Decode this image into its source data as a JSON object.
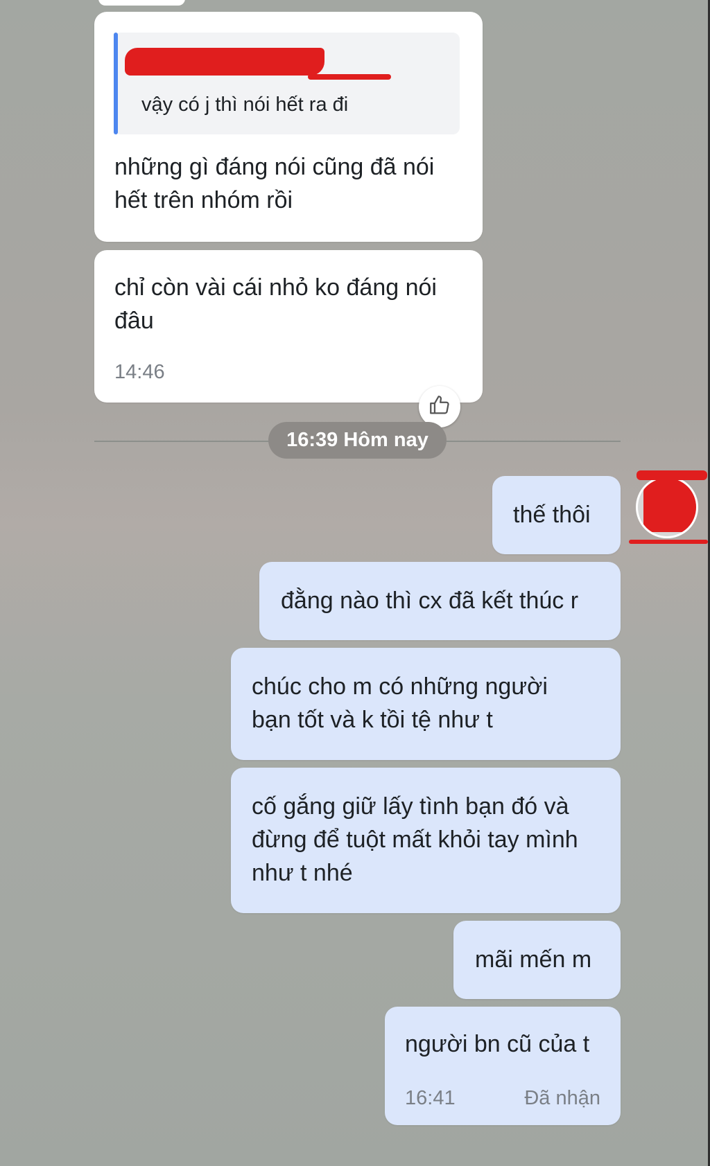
{
  "messages": {
    "incoming": [
      {
        "reply_sender": "",
        "reply_text": "vậy có j thì nói hết ra đi",
        "text": "những gì đáng nói cũng đã nói hết trên nhóm rồi"
      },
      {
        "text": "chỉ còn vài cái nhỏ ko đáng nói đâu",
        "time": "14:46"
      }
    ],
    "divider_label": "16:39 Hôm nay",
    "outgoing": [
      {
        "text": "thế thôi"
      },
      {
        "text": "đằng nào thì cx đã kết thúc r"
      },
      {
        "text": "chúc cho m có những người bạn tốt và k tồi tệ như t"
      },
      {
        "text": "cố gắng giữ lấy tình bạn đó và đừng để tuột mất khỏi tay mình như t nhé"
      },
      {
        "text": "mãi mến m"
      },
      {
        "text": "người bn cũ của t",
        "time": "16:41",
        "status": "Đã nhận"
      }
    ]
  },
  "icons": {
    "reaction": "thumbs-up-icon",
    "avatar": "avatar"
  },
  "colors": {
    "incoming_bubble": "#ffffff",
    "outgoing_bubble": "#dbe6fb",
    "quote_bar": "#4d86ef",
    "redaction": "#e01e1e"
  }
}
